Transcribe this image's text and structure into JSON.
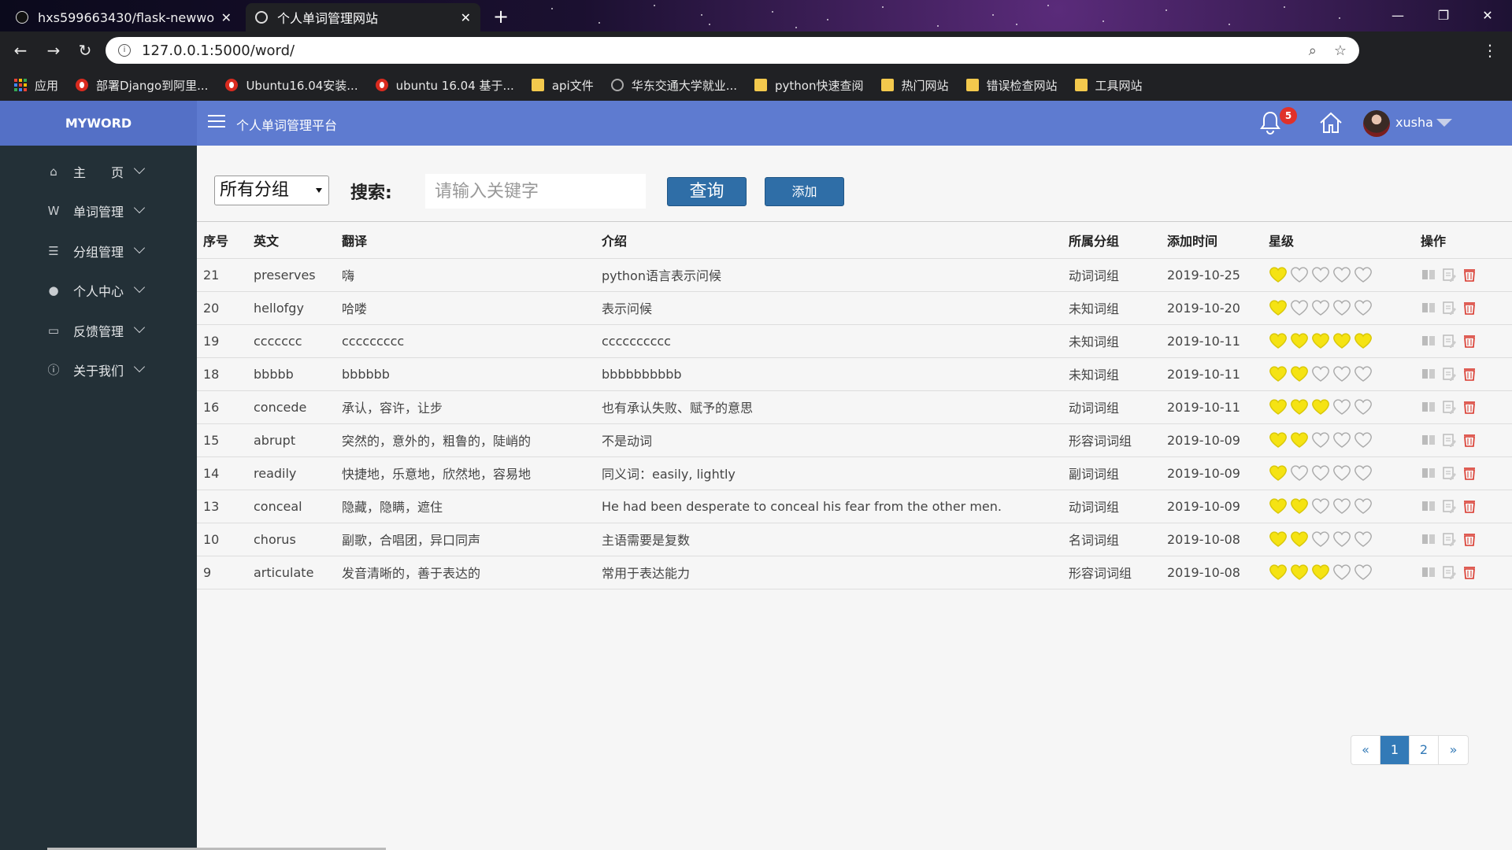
{
  "browser": {
    "tabs": [
      {
        "title": "hxs599663430/flask-newword",
        "active": false
      },
      {
        "title": "个人单词管理网站",
        "active": true
      }
    ],
    "url": "127.0.0.1:5000/word/",
    "bookmarks": [
      {
        "label": "应用",
        "icon": "apps-icon"
      },
      {
        "label": "部署Django到阿里...",
        "icon": "csdn-icon"
      },
      {
        "label": "Ubuntu16.04安装...",
        "icon": "csdn-icon"
      },
      {
        "label": "ubuntu 16.04 基于...",
        "icon": "csdn-icon"
      },
      {
        "label": "api文件",
        "icon": "folder-icon"
      },
      {
        "label": "华东交通大学就业...",
        "icon": "globe-icon"
      },
      {
        "label": "python快速查阅",
        "icon": "folder-icon"
      },
      {
        "label": "热门网站",
        "icon": "folder-icon"
      },
      {
        "label": "错误检查网站",
        "icon": "folder-icon"
      },
      {
        "label": "工具网站",
        "icon": "folder-icon"
      }
    ]
  },
  "app": {
    "brand": "MYWORD",
    "platform_title": "个人单词管理平台",
    "notifications": "5",
    "username": "xusha"
  },
  "sidebar": {
    "items": [
      {
        "label": "主　　页",
        "icon": "home-icon"
      },
      {
        "label": "单词管理",
        "icon": "word-icon"
      },
      {
        "label": "分组管理",
        "icon": "list-icon"
      },
      {
        "label": "个人中心",
        "icon": "user-icon"
      },
      {
        "label": "反馈管理",
        "icon": "feedback-icon"
      },
      {
        "label": "关于我们",
        "icon": "info-icon"
      }
    ]
  },
  "toolbar": {
    "group_select": "所有分组",
    "search_label": "搜索:",
    "search_placeholder": "请输入关键字",
    "query_label": "查询",
    "add_label": "添加"
  },
  "table": {
    "headers": [
      "序号",
      "英文",
      "翻译",
      "介绍",
      "所属分组",
      "添加时间",
      "星级",
      "操作"
    ],
    "rows": [
      {
        "id": "21",
        "english": "preserves",
        "translation": "嗨",
        "intro": "python语言表示问候",
        "group": "动词词组",
        "date": "2019-10-25",
        "stars": 1
      },
      {
        "id": "20",
        "english": "hellofgy",
        "translation": "哈喽",
        "intro": "表示问候",
        "group": "未知词组",
        "date": "2019-10-20",
        "stars": 1
      },
      {
        "id": "19",
        "english": "ccccccc",
        "translation": "ccccccccc",
        "intro": "cccccccccc",
        "group": "未知词组",
        "date": "2019-10-11",
        "stars": 5
      },
      {
        "id": "18",
        "english": "bbbbb",
        "translation": "bbbbbb",
        "intro": "bbbbbbbbbb",
        "group": "未知词组",
        "date": "2019-10-11",
        "stars": 2
      },
      {
        "id": "16",
        "english": "concede",
        "translation": "承认，容许，让步",
        "intro": "也有承认失败、赋予的意思",
        "group": "动词词组",
        "date": "2019-10-11",
        "stars": 3
      },
      {
        "id": "15",
        "english": "abrupt",
        "translation": "突然的，意外的，粗鲁的，陡峭的",
        "intro": "不是动词",
        "group": "形容词词组",
        "date": "2019-10-09",
        "stars": 2
      },
      {
        "id": "14",
        "english": "readily",
        "translation": "快捷地，乐意地，欣然地，容易地",
        "intro": "同义词：easily, lightly",
        "group": "副词词组",
        "date": "2019-10-09",
        "stars": 1
      },
      {
        "id": "13",
        "english": "conceal",
        "translation": "隐藏，隐瞒，遮住",
        "intro": "He had been desperate to conceal his fear from the other men.",
        "group": "动词词组",
        "date": "2019-10-09",
        "stars": 2
      },
      {
        "id": "10",
        "english": "chorus",
        "translation": "副歌，合唱团，异口同声",
        "intro": "主语需要是复数",
        "group": "名词词组",
        "date": "2019-10-08",
        "stars": 2
      },
      {
        "id": "9",
        "english": "articulate",
        "translation": "发音清晰的，善于表达的",
        "intro": "常用于表达能力",
        "group": "形容词词组",
        "date": "2019-10-08",
        "stars": 3
      }
    ]
  },
  "pagination": [
    "«",
    "1",
    "2",
    "»"
  ],
  "pagination_active": "1",
  "colors": {
    "header_bg": "#5e7bd0",
    "sidebar_bg": "#233037",
    "button": "#2f6ea7",
    "star_filled": "#f5e313",
    "delete_icon": "#d9362b"
  }
}
